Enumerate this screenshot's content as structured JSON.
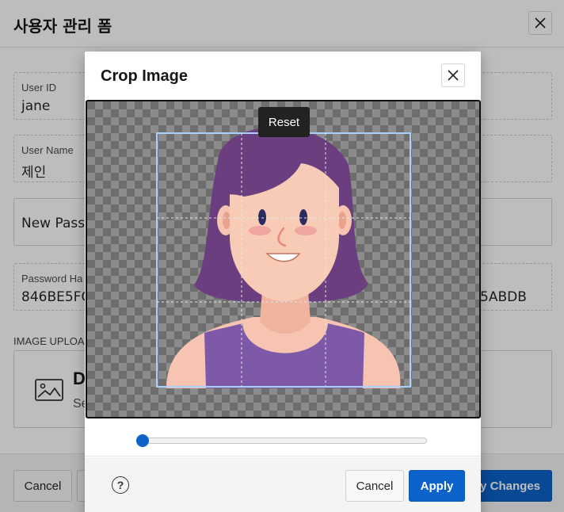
{
  "page": {
    "title": "사용자 관리 폼",
    "fields": {
      "user_id": {
        "label": "User ID",
        "value": "jane"
      },
      "user_name": {
        "label": "User Name",
        "value": "제인"
      },
      "new_password": {
        "placeholder": "New Passw"
      },
      "password_hash": {
        "label": "Password Ha",
        "value": "846BE5FC",
        "value_tail": "5ABDB"
      }
    },
    "image_upload": {
      "label": "IMAGE UPLOA",
      "drop_title": "D",
      "drop_subtitle": "Se"
    },
    "footer": {
      "cancel_label": "Cancel",
      "apply_changes_label": "y Changes"
    }
  },
  "dialog": {
    "title": "Crop Image",
    "reset_label": "Reset",
    "zoom_level": 0.0,
    "help_label": "?",
    "cancel_label": "Cancel",
    "apply_label": "Apply"
  },
  "colors": {
    "primary": "#0b63c9",
    "hair": "#6b3f7f",
    "skin": "#f6c4b0",
    "shirt": "#7e59a8"
  },
  "icons": [
    "close-icon",
    "image-icon",
    "help-icon"
  ]
}
